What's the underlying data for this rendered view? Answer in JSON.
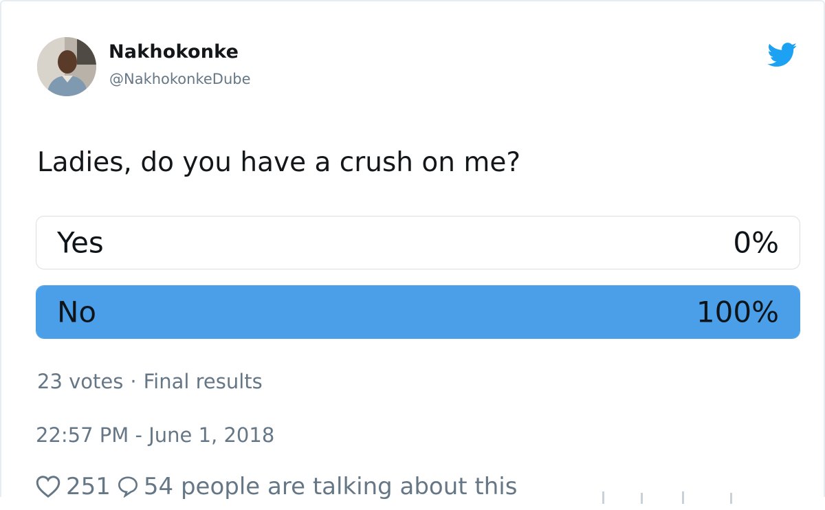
{
  "user": {
    "name": "Nakhokonke",
    "handle": "@NakhokonkeDube"
  },
  "icons": {
    "avatar": "profile-photo",
    "brand": "twitter-bird-icon",
    "like": "heart-icon",
    "reply": "comment-bubble-icon"
  },
  "colors": {
    "brand": "#1da1f2",
    "poll_winner_fill": "#4a9fe8",
    "muted_text": "#657786"
  },
  "tweet": {
    "text": "Ladies, do you have a crush on me?"
  },
  "poll": {
    "options": [
      {
        "label": "Yes",
        "percent_label": "0%",
        "share": 0
      },
      {
        "label": "No",
        "percent_label": "100%",
        "share": 1
      }
    ],
    "votes": "23 votes",
    "separator": "·",
    "status": "Final results"
  },
  "timestamp": "22:57 PM - June 1, 2018",
  "engagement": {
    "likes": "251",
    "talking": "54 people are talking about this"
  }
}
